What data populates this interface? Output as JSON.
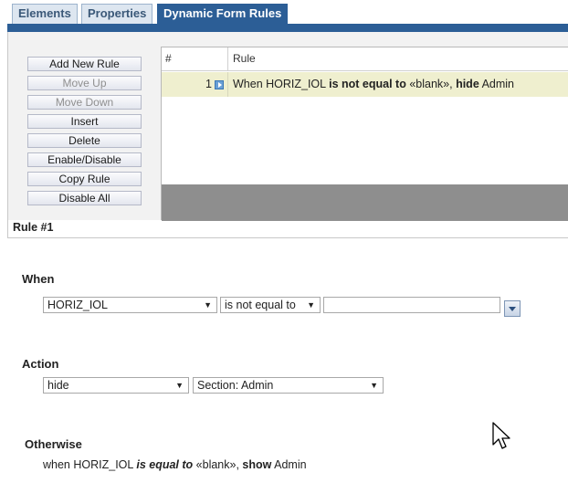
{
  "tabs": [
    {
      "label": "Elements"
    },
    {
      "label": "Properties"
    },
    {
      "label": "Dynamic Form Rules"
    }
  ],
  "rule_buttons": [
    {
      "label": "Add New Rule"
    },
    {
      "label": "Move Up"
    },
    {
      "label": "Move Down"
    },
    {
      "label": "Insert"
    },
    {
      "label": "Delete"
    },
    {
      "label": "Enable/Disable"
    },
    {
      "label": "Copy Rule"
    },
    {
      "label": "Disable All"
    }
  ],
  "grid": {
    "col_num": "#",
    "col_rule": "Rule",
    "rows": [
      {
        "num": "1",
        "t1": "When HORIZ_IOL ",
        "t2": "is not equal to",
        "t3": " «blank», ",
        "t4": "hide",
        "t5": " Admin"
      }
    ]
  },
  "rule_title": "Rule #1",
  "when": {
    "label": "When",
    "field": "HORIZ_IOL",
    "operator": "is not equal to",
    "value": ""
  },
  "action": {
    "label": "Action",
    "verb": "hide",
    "target": "Section: Admin"
  },
  "otherwise": {
    "label": "Otherwise",
    "t1": "when HORIZ_IOL ",
    "t2": "is equal to",
    "t3": " «blank», ",
    "t4": "show",
    "t5": " Admin"
  },
  "colors": {
    "accent": "#2c5e96",
    "row_highlight": "#efefcf",
    "panel": "#f2f2f2"
  }
}
